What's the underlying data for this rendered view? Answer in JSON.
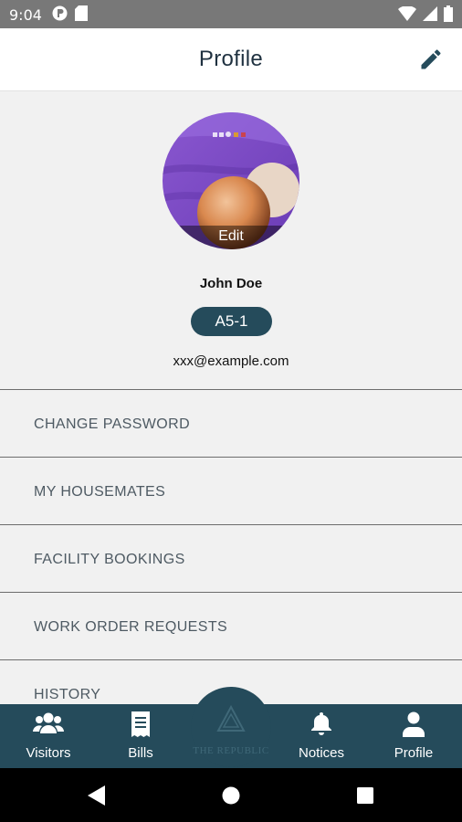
{
  "status_bar": {
    "time": "9:04"
  },
  "header": {
    "title": "Profile"
  },
  "profile": {
    "avatar_edit_label": "Edit",
    "name": "John Doe",
    "unit": "A5-1",
    "email": "xxx@example.com"
  },
  "menu": [
    {
      "label": "CHANGE PASSWORD"
    },
    {
      "label": "MY HOUSEMATES"
    },
    {
      "label": "FACILITY BOOKINGS"
    },
    {
      "label": "WORK ORDER REQUESTS"
    },
    {
      "label": "HISTORY"
    }
  ],
  "bottom_nav": {
    "items": [
      {
        "label": "Visitors",
        "icon": "users-icon"
      },
      {
        "label": "Bills",
        "icon": "receipt-icon"
      },
      {
        "label": "Notices",
        "icon": "bell-icon"
      },
      {
        "label": "Profile",
        "icon": "person-icon"
      }
    ],
    "logo_text": "THE REPUBLIC"
  },
  "colors": {
    "primary": "#254b5b",
    "status_bar": "#787878",
    "background": "#f1f1f1"
  }
}
